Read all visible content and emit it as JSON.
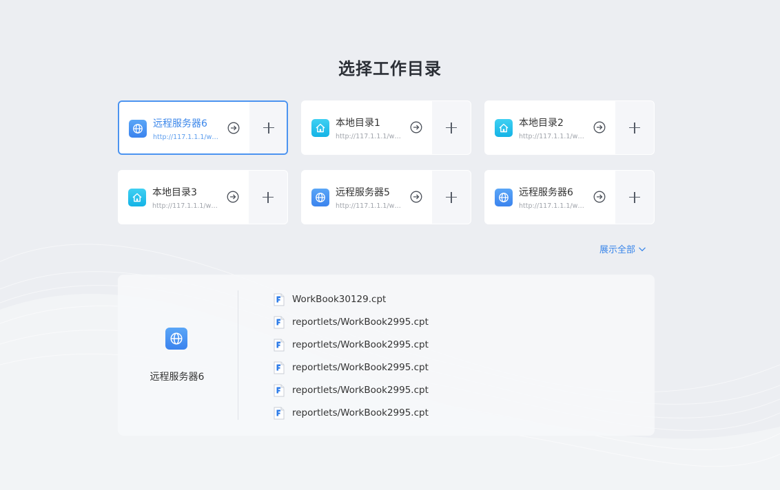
{
  "page_title": "选择工作目录",
  "cards": [
    {
      "name": "远程服务器6",
      "url": "http://117.1.1.1/web...",
      "icon": "globe-icon",
      "active": true
    },
    {
      "name": "本地目录1",
      "url": "http://117.1.1.1/web...",
      "icon": "home-icon",
      "active": false
    },
    {
      "name": "本地目录2",
      "url": "http://117.1.1.1/web...",
      "icon": "home-icon",
      "active": false
    },
    {
      "name": "本地目录3",
      "url": "http://117.1.1.1/web...",
      "icon": "home-icon",
      "active": false
    },
    {
      "name": "远程服务器5",
      "url": "http://117.1.1.1/web...",
      "icon": "globe-icon",
      "active": false
    },
    {
      "name": "远程服务器6",
      "url": "http://117.1.1.1/web...",
      "icon": "globe-icon",
      "active": false
    }
  ],
  "show_all_label": "展示全部",
  "detail": {
    "server_name": "远程服务器6",
    "files": [
      "WorkBook30129.cpt",
      "reportlets/WorkBook2995.cpt",
      "reportlets/WorkBook2995.cpt",
      "reportlets/WorkBook2995.cpt",
      "reportlets/WorkBook2995.cpt",
      "reportlets/WorkBook2995.cpt"
    ]
  },
  "colors": {
    "accent": "#3a86ea",
    "globe_icon": "#3b83ee",
    "home_icon": "#14b3e6",
    "background": "#eceef2"
  }
}
